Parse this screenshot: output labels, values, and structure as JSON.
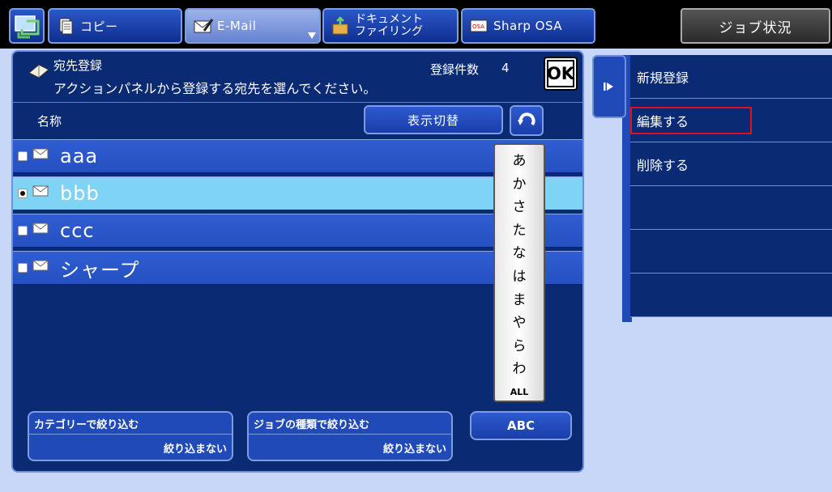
{
  "tabs": {
    "copy": "コピー",
    "email": "E-Mail",
    "docfiling_line1": "ドキュメント",
    "docfiling_line2": "ファイリング",
    "osa": "Sharp OSA"
  },
  "job_status": "ジョブ状況",
  "header": {
    "title": "宛先登録",
    "message": "アクションパネルから登録する宛先を選んでください。",
    "count_label": "登録件数",
    "count_value": "4",
    "ok_label": "OK"
  },
  "column": {
    "name_label": "名称",
    "switch_label": "表示切替"
  },
  "entries": [
    {
      "name": "aaa",
      "selected": false
    },
    {
      "name": "bbb",
      "selected": true
    },
    {
      "name": "ccc",
      "selected": false
    },
    {
      "name": "シャープ",
      "selected": false
    }
  ],
  "kana_index": [
    "あ",
    "か",
    "さ",
    "た",
    "な",
    "は",
    "ま",
    "や",
    "ら",
    "わ",
    "ALL"
  ],
  "filters": {
    "category_title": "カテゴリーで絞り込む",
    "category_value": "絞り込まない",
    "jobtype_title": "ジョブの種類で絞り込む",
    "jobtype_value": "絞り込まない",
    "abc_label": "ABC"
  },
  "actions": [
    "新規登録",
    "編集する",
    "削除する",
    "",
    "",
    ""
  ],
  "colors": {
    "accent_red": "#e3101a",
    "panel_blue": "#0a2a74",
    "selected_row": "#7fd4f5"
  }
}
